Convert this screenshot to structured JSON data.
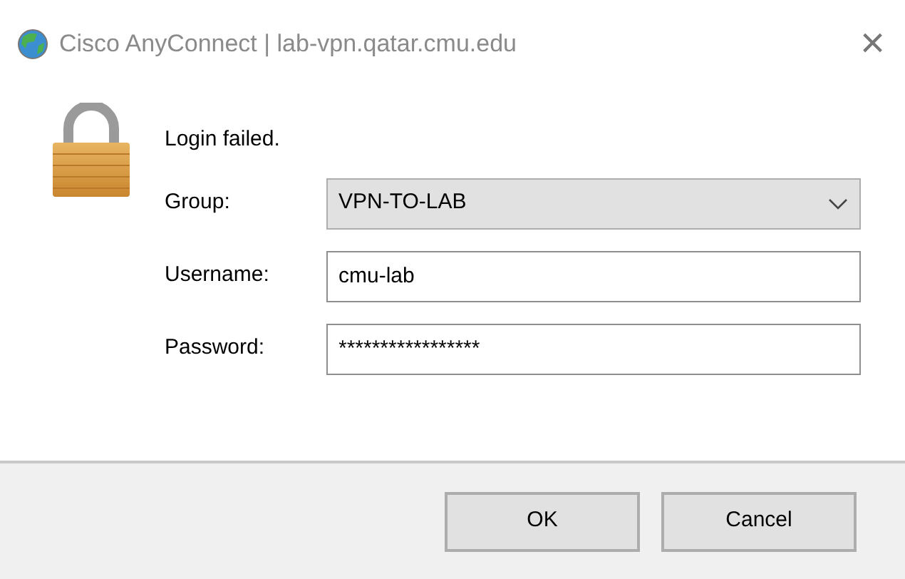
{
  "window": {
    "title": "Cisco AnyConnect | lab-vpn.qatar.cmu.edu",
    "close": "×"
  },
  "message": "Login failed.",
  "fields": [
    {
      "kind": "select",
      "label": "Group:",
      "value": "VPN-TO-LAB"
    },
    {
      "kind": "text",
      "label": "Username:",
      "value": "cmu-lab"
    },
    {
      "kind": "text",
      "label": "Password:",
      "value": "*****************"
    }
  ],
  "buttons": [
    "OK",
    "Cancel"
  ]
}
